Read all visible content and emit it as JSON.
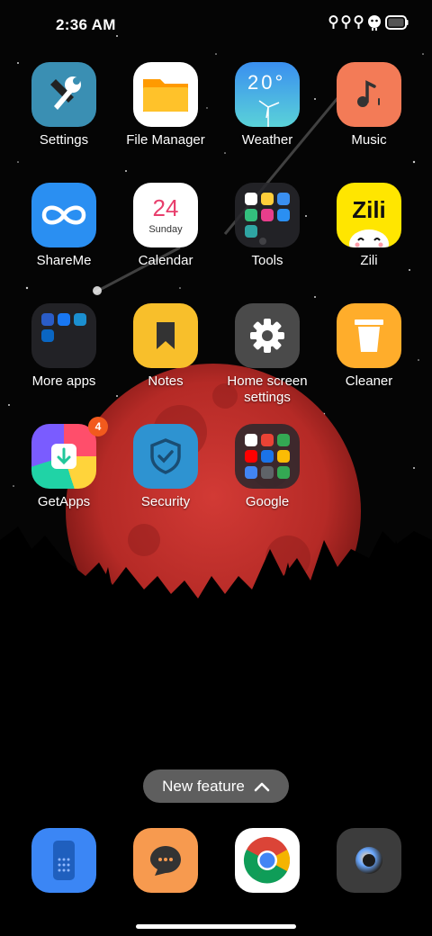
{
  "status_bar": {
    "time": "2:36 AM",
    "icons": [
      "notification-icon",
      "notification-icon",
      "notification-icon",
      "android-icon",
      "battery-icon"
    ]
  },
  "apps": [
    {
      "name": "settings",
      "label": "Settings",
      "icon": "wrench-icon",
      "color": "#3a8fb3"
    },
    {
      "name": "file-manager",
      "label": "File Manager",
      "icon": "folder-icon",
      "color": "#ffb21c"
    },
    {
      "name": "weather",
      "label": "Weather",
      "icon": "weather-icon",
      "text": "20°",
      "color": "#4fb0ee"
    },
    {
      "name": "music",
      "label": "Music",
      "icon": "music-note-icon",
      "color": "#f37b57"
    },
    {
      "name": "shareme",
      "label": "ShareMe",
      "icon": "infinity-icon",
      "color": "#2a8ff2"
    },
    {
      "name": "calendar",
      "label": "Calendar",
      "icon": "calendar-icon",
      "day": "24",
      "weekday": "Sunday",
      "color": "#e83e6c"
    },
    {
      "name": "tools",
      "label": "Tools",
      "icon": "folder-icon"
    },
    {
      "name": "zili",
      "label": "Zili",
      "icon": "zili-icon",
      "text": "Zili",
      "color": "#ffe600"
    },
    {
      "name": "more-apps",
      "label": "More apps",
      "icon": "folder-icon"
    },
    {
      "name": "notes",
      "label": "Notes",
      "icon": "bookmark-icon",
      "color": "#f8bf2b"
    },
    {
      "name": "home-screen-settings",
      "label": "Home screen settings",
      "icon": "gear-icon",
      "color": "#4a4a4a"
    },
    {
      "name": "cleaner",
      "label": "Cleaner",
      "icon": "trash-icon",
      "color": "#ffad2b"
    },
    {
      "name": "getapps",
      "label": "GetApps",
      "icon": "getapps-icon",
      "badge": "4",
      "color": "#f25a1d"
    },
    {
      "name": "security",
      "label": "Security",
      "icon": "shield-icon",
      "color": "#2e93d1"
    },
    {
      "name": "google",
      "label": "Google",
      "icon": "folder-icon"
    }
  ],
  "new_feature": {
    "label": "New feature",
    "icon": "chevron-up-icon"
  },
  "dock": [
    {
      "name": "phone",
      "icon": "dialpad-icon",
      "color": "#3b86f5"
    },
    {
      "name": "messaging",
      "icon": "chat-icon",
      "color": "#f79a4f"
    },
    {
      "name": "chrome",
      "icon": "chrome-icon"
    },
    {
      "name": "camera",
      "icon": "camera-icon",
      "color": "#3c3c3c"
    }
  ]
}
